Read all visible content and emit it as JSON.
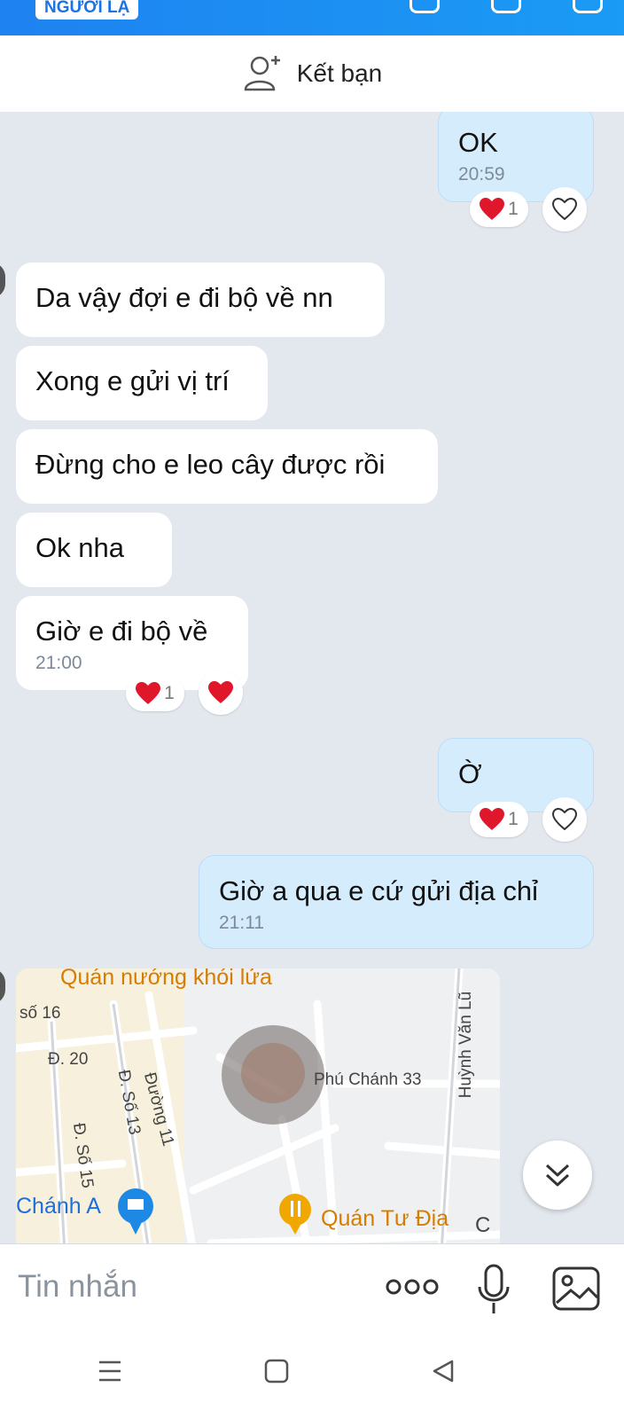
{
  "header": {
    "badge": "NGƯỜI LẠ",
    "background": "#1e82f0"
  },
  "add_friend": {
    "label": "Kết bạn",
    "icon": "add-person-icon"
  },
  "messages": [
    {
      "side": "out",
      "text": "OK",
      "time": "20:59",
      "reaction_count": "1"
    },
    {
      "side": "in",
      "text": "Da vậy đợi e đi bộ về nn"
    },
    {
      "side": "in",
      "text": "Xong e gửi vị trí"
    },
    {
      "side": "in",
      "text": "Đừng cho e leo cây được rồi"
    },
    {
      "side": "in",
      "text": "Ok nha"
    },
    {
      "side": "in",
      "text": "Giờ e đi bộ về",
      "time": "21:00",
      "reaction_count": "1"
    },
    {
      "side": "out",
      "text": "Ờ",
      "reaction_count": "1"
    },
    {
      "side": "out",
      "text": "Giờ a qua e cứ gửi địa chỉ",
      "time": "21:11"
    }
  ],
  "map": {
    "labels": {
      "quan_nuong": "Quán nướng khói lửa",
      "so16": "số 16",
      "d20": "Đ. 20",
      "dso13": "Đ. Số 13",
      "duong11": "Đường 11",
      "dso15": "Đ. Số 15",
      "chanh_a": "Chánh A",
      "phu_chanh": "Phú Chánh 33",
      "huynh_van_lu": "Huỳnh Văn Lũ",
      "quan_tu_dia": "Quán Tư Địa",
      "edge_c": "C"
    }
  },
  "composer": {
    "placeholder": "Tin nhắn"
  },
  "colors": {
    "accent": "#1e82f0",
    "outgoing_bubble": "#d5ecfd",
    "chat_bg": "#e3e8ee",
    "heart": "#e0162b"
  }
}
